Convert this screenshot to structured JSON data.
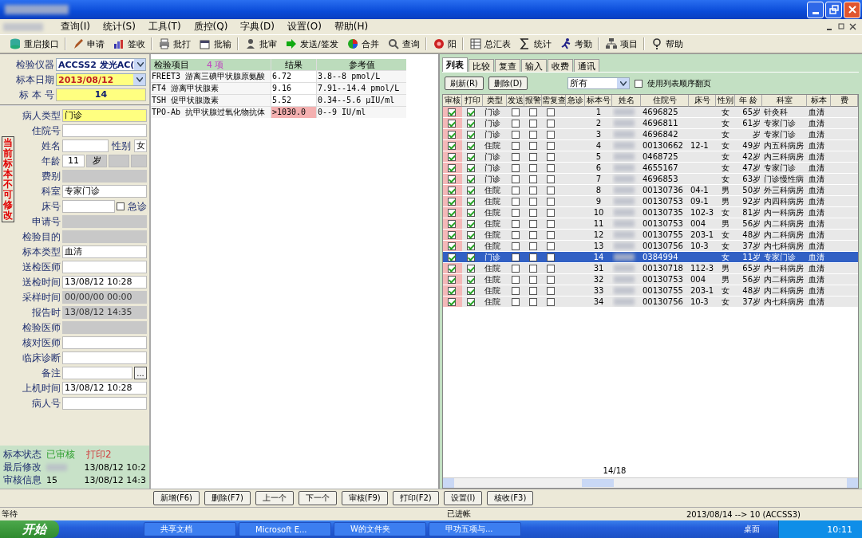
{
  "menu": [
    "查询(I)",
    "统计(S)",
    "工具(T)",
    "质控(Q)",
    "字典(D)",
    "设置(O)",
    "帮助(H)"
  ],
  "toolbar": [
    "重启接口",
    "申请",
    "签收",
    "批打",
    "批输",
    "批审",
    "发送/签发",
    "合并",
    "查询",
    "阳",
    "总汇表",
    "统计",
    "考勤",
    "项目",
    "帮助"
  ],
  "header": {
    "instrument_label": "检验仪器",
    "instrument": "ACCSS2 发光AC(",
    "date_label": "标本日期",
    "date": "2013/08/12",
    "sample_label": "标 本 号",
    "sample": "14"
  },
  "lock_notice": "当前标本不可修改",
  "form": [
    {
      "kind": "field",
      "label": "病人类型",
      "value": "门诊",
      "highlighted": true,
      "disabled": false
    },
    {
      "kind": "field",
      "label": "住院号",
      "highlighted": false,
      "disabled": false
    },
    {
      "kind": "name",
      "label": "姓名",
      "sex_label": "性别",
      "sex": "女"
    },
    {
      "kind": "age",
      "label": "年龄",
      "age": "11",
      "unit": "岁"
    },
    {
      "kind": "field",
      "label": "费别",
      "highlighted": false,
      "disabled": true
    },
    {
      "kind": "field",
      "label": "科室",
      "value": "专家门诊",
      "highlighted": false,
      "disabled": false
    },
    {
      "kind": "bed",
      "label": "床号",
      "urgent_label": "急诊",
      "urgent": false
    },
    {
      "kind": "field",
      "label": "申请号",
      "highlighted": false,
      "disabled": true
    },
    {
      "kind": "field",
      "label": "检验目的",
      "highlighted": false,
      "disabled": true
    },
    {
      "kind": "field",
      "label": "标本类型",
      "value": "血清",
      "highlighted": false,
      "disabled": false
    },
    {
      "kind": "field",
      "label": "送检医师",
      "highlighted": false,
      "disabled": false
    },
    {
      "kind": "field",
      "label": "送检时间",
      "value": "13/08/12 10:28",
      "highlighted": false,
      "disabled": false
    },
    {
      "kind": "field",
      "label": "采样时间",
      "value": "00/00/00 00:00",
      "highlighted": false,
      "disabled": true
    },
    {
      "kind": "field",
      "label": "报告时",
      "value": "13/08/12 14:35",
      "highlighted": false,
      "disabled": true
    },
    {
      "kind": "field",
      "label": "检验医师",
      "highlighted": false,
      "disabled": true
    },
    {
      "kind": "field",
      "label": "核对医师",
      "highlighted": false,
      "disabled": false
    },
    {
      "kind": "field",
      "label": "临床诊断",
      "highlighted": false,
      "disabled": false
    },
    {
      "kind": "note",
      "label": "备注",
      "button": "..."
    },
    {
      "kind": "field",
      "label": "上机时间",
      "value": "13/08/12 10:28",
      "highlighted": false,
      "disabled": false
    },
    {
      "kind": "field",
      "label": "病人号",
      "highlighted": false,
      "disabled": false
    }
  ],
  "status": {
    "state_label": "标本状态",
    "state": "已审核",
    "print": "打印2",
    "modified_label": "最后修改",
    "modified_time": "13/08/12 10:2",
    "audit_label": "审核信息",
    "audit_user": "15",
    "audit_time": "13/08/12 14:3"
  },
  "results": {
    "columns": [
      "检验项目",
      "结果",
      "参考值"
    ],
    "count": "4 项",
    "rows": [
      {
        "item": "FREET3 游离三碘甲状腺原氨酸",
        "result": "6.72",
        "range": "3.8--8 pmol/L",
        "abnormal": false
      },
      {
        "item": "FT4 游离甲状腺素",
        "result": "9.16",
        "range": "7.91--14.4 pmol/L",
        "abnormal": false
      },
      {
        "item": "TSH 促甲状腺激素",
        "result": "5.52",
        "range": "0.34--5.6 μIU/ml",
        "abnormal": false
      },
      {
        "item": "TPO-Ab 抗甲状腺过氧化物抗体",
        "result": ">1030.0",
        "range": "0--9 IU/ml",
        "abnormal": true
      }
    ]
  },
  "tabs": [
    {
      "label": "列表",
      "selected": true
    },
    {
      "label": "比较",
      "selected": false
    },
    {
      "label": "复查",
      "selected": false
    },
    {
      "label": "输入",
      "selected": false
    },
    {
      "label": "收费",
      "selected": false
    },
    {
      "label": "通讯",
      "selected": false
    }
  ],
  "list_toolbar": {
    "refresh": "刷新(R)",
    "delete": "删除(D)",
    "filter": "所有",
    "order_label": "使用列表顺序翻页",
    "order": false
  },
  "list": {
    "columns": [
      "审核",
      "打印",
      "类型",
      "发送",
      "报警",
      "需复查",
      "急诊",
      "标本号",
      "姓名",
      "住院号",
      "床号",
      "性别",
      "年 龄",
      "科室",
      "标本",
      "费"
    ],
    "rows": [
      {
        "audited": true,
        "printed": true,
        "type": "门诊",
        "sent": false,
        "alarm": false,
        "recheck": false,
        "no": "1",
        "inpatient": "4696825",
        "bed": "",
        "sex": "女",
        "age": "65岁",
        "dept": "针灸科",
        "sample": "血清",
        "selected": false
      },
      {
        "audited": true,
        "printed": true,
        "type": "门诊",
        "sent": false,
        "alarm": false,
        "recheck": false,
        "no": "2",
        "inpatient": "4696811",
        "bed": "",
        "sex": "女",
        "age": "61岁",
        "dept": "专家门诊",
        "sample": "血清",
        "selected": false
      },
      {
        "audited": true,
        "printed": true,
        "type": "门诊",
        "sent": false,
        "alarm": false,
        "recheck": false,
        "no": "3",
        "inpatient": "4696842",
        "bed": "",
        "sex": "女",
        "age": "岁",
        "dept": "专家门诊",
        "sample": "血清",
        "selected": false
      },
      {
        "audited": true,
        "printed": true,
        "type": "住院",
        "sent": false,
        "alarm": false,
        "recheck": false,
        "no": "4",
        "inpatient": "00130662",
        "bed": "12-1",
        "sex": "女",
        "age": "49岁",
        "dept": "内五科病房",
        "sample": "血清",
        "selected": false
      },
      {
        "audited": true,
        "printed": true,
        "type": "门诊",
        "sent": false,
        "alarm": false,
        "recheck": false,
        "no": "5",
        "inpatient": "0468725",
        "bed": "",
        "sex": "女",
        "age": "42岁",
        "dept": "内三科病房",
        "sample": "血清",
        "selected": false
      },
      {
        "audited": true,
        "printed": true,
        "type": "门诊",
        "sent": false,
        "alarm": false,
        "recheck": false,
        "no": "6",
        "inpatient": "4655167",
        "bed": "",
        "sex": "女",
        "age": "47岁",
        "dept": "专家门诊",
        "sample": "血清",
        "selected": false
      },
      {
        "audited": true,
        "printed": true,
        "type": "门诊",
        "sent": false,
        "alarm": false,
        "recheck": false,
        "no": "7",
        "inpatient": "4696853",
        "bed": "",
        "sex": "女",
        "age": "63岁",
        "dept": "门诊慢性病",
        "sample": "血清",
        "selected": false
      },
      {
        "audited": true,
        "printed": true,
        "type": "住院",
        "sent": false,
        "alarm": false,
        "recheck": false,
        "no": "8",
        "inpatient": "00130736",
        "bed": "04-1",
        "sex": "男",
        "age": "50岁",
        "dept": "外三科病房",
        "sample": "血清",
        "selected": false
      },
      {
        "audited": true,
        "printed": true,
        "type": "住院",
        "sent": false,
        "alarm": false,
        "recheck": false,
        "no": "9",
        "inpatient": "00130753",
        "bed": "09-1",
        "sex": "男",
        "age": "92岁",
        "dept": "内四科病房",
        "sample": "血清",
        "selected": false
      },
      {
        "audited": true,
        "printed": true,
        "type": "住院",
        "sent": false,
        "alarm": false,
        "recheck": false,
        "no": "10",
        "inpatient": "00130735",
        "bed": "102-3",
        "sex": "女",
        "age": "81岁",
        "dept": "内一科病房",
        "sample": "血清",
        "selected": false
      },
      {
        "audited": true,
        "printed": true,
        "type": "住院",
        "sent": false,
        "alarm": false,
        "recheck": false,
        "no": "11",
        "inpatient": "00130753",
        "bed": "004",
        "sex": "男",
        "age": "56岁",
        "dept": "内二科病房",
        "sample": "血清",
        "selected": false
      },
      {
        "audited": true,
        "printed": true,
        "type": "住院",
        "sent": false,
        "alarm": false,
        "recheck": false,
        "no": "12",
        "inpatient": "00130755",
        "bed": "203-1",
        "sex": "女",
        "age": "48岁",
        "dept": "内二科病房",
        "sample": "血清",
        "selected": false
      },
      {
        "audited": true,
        "printed": true,
        "type": "住院",
        "sent": false,
        "alarm": false,
        "recheck": false,
        "no": "13",
        "inpatient": "00130756",
        "bed": "10-3",
        "sex": "女",
        "age": "37岁",
        "dept": "内七科病房",
        "sample": "血清",
        "selected": false
      },
      {
        "audited": true,
        "printed": true,
        "type": "门诊",
        "sent": false,
        "alarm": false,
        "recheck": false,
        "no": "14",
        "inpatient": "0384994",
        "bed": "",
        "sex": "女",
        "age": "11岁",
        "dept": "专家门诊",
        "sample": "血清",
        "selected": true
      },
      {
        "audited": true,
        "printed": true,
        "type": "住院",
        "sent": false,
        "alarm": false,
        "recheck": false,
        "no": "31",
        "inpatient": "00130718",
        "bed": "112-3",
        "sex": "男",
        "age": "65岁",
        "dept": "内一科病房",
        "sample": "血清",
        "selected": false
      },
      {
        "audited": true,
        "printed": true,
        "type": "住院",
        "sent": false,
        "alarm": false,
        "recheck": false,
        "no": "32",
        "inpatient": "00130753",
        "bed": "004",
        "sex": "男",
        "age": "56岁",
        "dept": "内二科病房",
        "sample": "血清",
        "selected": false
      },
      {
        "audited": true,
        "printed": true,
        "type": "住院",
        "sent": false,
        "alarm": false,
        "recheck": false,
        "no": "33",
        "inpatient": "00130755",
        "bed": "203-1",
        "sex": "女",
        "age": "48岁",
        "dept": "内二科病房",
        "sample": "血清",
        "selected": false
      },
      {
        "audited": true,
        "printed": true,
        "type": "住院",
        "sent": false,
        "alarm": false,
        "recheck": false,
        "no": "34",
        "inpatient": "00130756",
        "bed": "10-3",
        "sex": "女",
        "age": "37岁",
        "dept": "内七科病房",
        "sample": "血清",
        "selected": false
      }
    ],
    "pager": "14/18"
  },
  "actions": [
    "新增(F6)",
    "删除(F7)",
    "上一个",
    "下一个",
    "审核(F9)",
    "打印(F2)",
    "设置(I)",
    "核收(F3)"
  ],
  "status_bar": {
    "left": "等待",
    "middle": "已进帐",
    "right": "2013/08/14 --> 10 (ACCSS3)"
  },
  "taskbar": {
    "start": "开始",
    "tasks": [
      "共享文档",
      "Microsoft E...",
      "W的文件夹",
      "甲功五项与..."
    ],
    "desktop": "桌面",
    "clock": "10:11"
  }
}
